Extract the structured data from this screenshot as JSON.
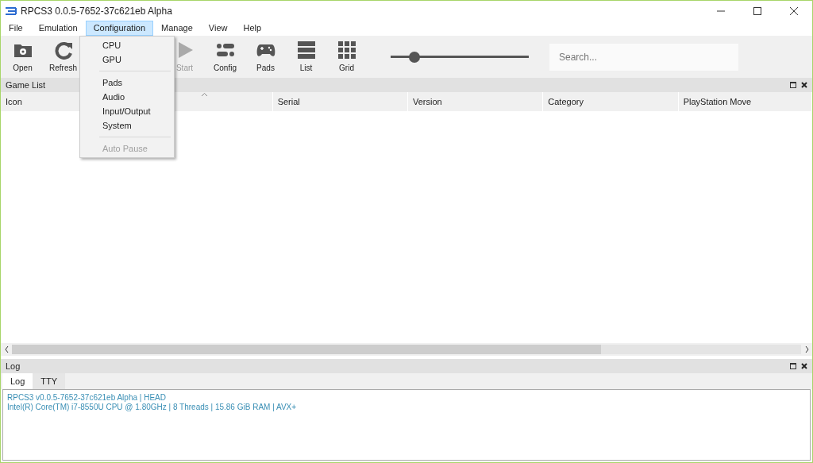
{
  "window": {
    "title": "RPCS3 0.0.5-7652-37c621eb Alpha"
  },
  "menu_bar": [
    {
      "label": "File",
      "selected": false
    },
    {
      "label": "Emulation",
      "selected": false
    },
    {
      "label": "Configuration",
      "selected": true
    },
    {
      "label": "Manage",
      "selected": false
    },
    {
      "label": "View",
      "selected": false
    },
    {
      "label": "Help",
      "selected": false
    }
  ],
  "open_menu": {
    "items": [
      {
        "kind": "item",
        "label": "CPU",
        "disabled": false
      },
      {
        "kind": "item",
        "label": "GPU",
        "disabled": false
      },
      {
        "kind": "separator"
      },
      {
        "kind": "item",
        "label": "Pads",
        "disabled": false
      },
      {
        "kind": "item",
        "label": "Audio",
        "disabled": false
      },
      {
        "kind": "item",
        "label": "Input/Output",
        "disabled": false
      },
      {
        "kind": "item",
        "label": "System",
        "disabled": false
      },
      {
        "kind": "separator"
      },
      {
        "kind": "item",
        "label": "Auto Pause",
        "disabled": true
      }
    ]
  },
  "toolbar": {
    "buttons": [
      {
        "kind": "button",
        "label": "Open",
        "disabled": false
      },
      {
        "kind": "button",
        "label": "Refresh",
        "disabled": false
      },
      {
        "kind": "hidden"
      },
      {
        "kind": "button",
        "label": "Start",
        "disabled": true
      },
      {
        "kind": "button",
        "label": "Config",
        "disabled": false
      },
      {
        "kind": "button",
        "label": "Pads",
        "disabled": false
      },
      {
        "kind": "button",
        "label": "List",
        "disabled": false
      },
      {
        "kind": "button",
        "label": "Grid",
        "disabled": false
      }
    ],
    "zoom_slider": {
      "level": 0.17
    },
    "search": {
      "placeholder": "Search..."
    }
  },
  "game_list": {
    "title": "Game List",
    "columns": [
      "Icon",
      "",
      "Serial",
      "Version",
      "Category",
      "PlayStation Move"
    ]
  },
  "log": {
    "title": "Log",
    "tabs": [
      {
        "label": "Log",
        "selected": true
      },
      {
        "label": "TTY",
        "selected": false
      }
    ],
    "lines": [
      "RPCS3 v0.0.5-7652-37c621eb Alpha | HEAD",
      "Intel(R) Core(TM) i7-8550U CPU @ 1.80GHz | 8 Threads | 15.86 GiB RAM | AVX+"
    ]
  }
}
